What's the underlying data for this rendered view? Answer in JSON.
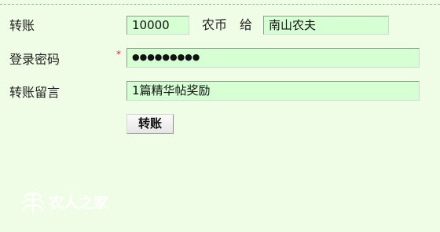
{
  "form": {
    "amount_label": "转账",
    "amount_value": "10000",
    "currency_text": "农币",
    "to_text": "给",
    "recipient_value": "南山农夫",
    "password_label": "登录密码",
    "required_mark": "*",
    "password_value": "●●●●●●●●●",
    "message_label": "转账留言",
    "message_value": "1篇精华帖奖励",
    "submit_label": "转账"
  },
  "watermark": {
    "text": "农人之家"
  }
}
